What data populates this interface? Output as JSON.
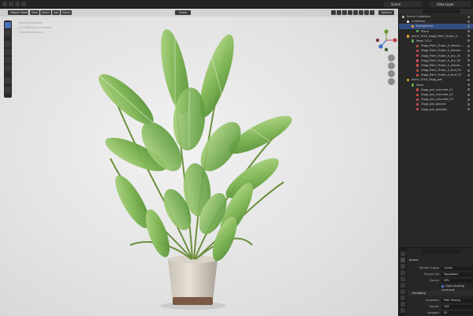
{
  "topbar": {
    "scene_name": "Scene",
    "view_layer": "View Layer"
  },
  "viewport": {
    "mode": "Object Mode",
    "menus": [
      "View",
      "Select",
      "Add",
      "Object"
    ],
    "orientation": "Global",
    "options_label": "Options",
    "overlay_lines": [
      "User Perspective",
      "(1) Collection | Camera",
      "Scene Collection"
    ]
  },
  "outliner": {
    "search_placeholder": "",
    "rows": [
      {
        "label": "Scene Collection",
        "indent": 0,
        "color": "#b5b5b5",
        "selected": false
      },
      {
        "label": "Collection",
        "indent": 1,
        "color": "#e6e6e6",
        "selected": false
      },
      {
        "label": "Background",
        "indent": 2,
        "color": "#e59b3b",
        "selected": true
      },
      {
        "label": "Plane",
        "indent": 3,
        "color": "#57a957",
        "selected": false
      },
      {
        "label": "plant_1016_Zagg_Palm_Tropic_h...",
        "indent": 1,
        "color": "#e59b3b",
        "selected": false
      },
      {
        "label": "Mesh 1011",
        "indent": 2,
        "color": "#57a957",
        "selected": false
      },
      {
        "label": "Zagg_Palm_Tropic_h_leaves...",
        "indent": 3,
        "color": "#c84b4b",
        "selected": false
      },
      {
        "label": "Zagg_Palm_Tropic_h_leaves...",
        "indent": 3,
        "color": "#c84b4b",
        "selected": false
      },
      {
        "label": "Zagg_Palm_Tropic_h_dry_01",
        "indent": 3,
        "color": "#c84b4b",
        "selected": false
      },
      {
        "label": "Zagg_Palm_Tropic_h_dry_02",
        "indent": 3,
        "color": "#c84b4b",
        "selected": false
      },
      {
        "label": "Zagg_Palm_Tropic_h_leaves...",
        "indent": 3,
        "color": "#c84b4b",
        "selected": false
      },
      {
        "label": "Zagg_Palm_Tropic_h_bud_01",
        "indent": 3,
        "color": "#c84b4b",
        "selected": false
      },
      {
        "label": "Zagg_Palm_Tropic_h_bud_02",
        "indent": 3,
        "color": "#c84b4b",
        "selected": false
      },
      {
        "label": "plant_1016_Zagg_pot",
        "indent": 1,
        "color": "#e59b3b",
        "selected": false
      },
      {
        "label": "Mesh",
        "indent": 2,
        "color": "#57a957",
        "selected": false
      },
      {
        "label": "Zagg_pot_concrete_01",
        "indent": 3,
        "color": "#c84b4b",
        "selected": false
      },
      {
        "label": "Zagg_pot_concrete_02",
        "indent": 3,
        "color": "#c84b4b",
        "selected": false
      },
      {
        "label": "Zagg_pot_concrete_03",
        "indent": 3,
        "color": "#c84b4b",
        "selected": false
      },
      {
        "label": "Zagg_pot_ground",
        "indent": 3,
        "color": "#c84b4b",
        "selected": false
      },
      {
        "label": "Zagg_pot_pebbles",
        "indent": 3,
        "color": "#c84b4b",
        "selected": false
      }
    ]
  },
  "properties": {
    "section_title": "Scene",
    "render_engine_label": "Render Engine",
    "render_engine_value": "Cycles",
    "feature_set_label": "Feature Set",
    "feature_set_value": "Supported",
    "device_label": "Device",
    "device_value": "CPU",
    "open_shading_label": "Open Shading Language",
    "sampling_label": "Sampling",
    "integrator_label": "Integrator",
    "integrator_value": "Path Tracing",
    "render_label": "Render",
    "render_value": "128",
    "viewport_label": "Viewport",
    "viewport_value": "32"
  }
}
